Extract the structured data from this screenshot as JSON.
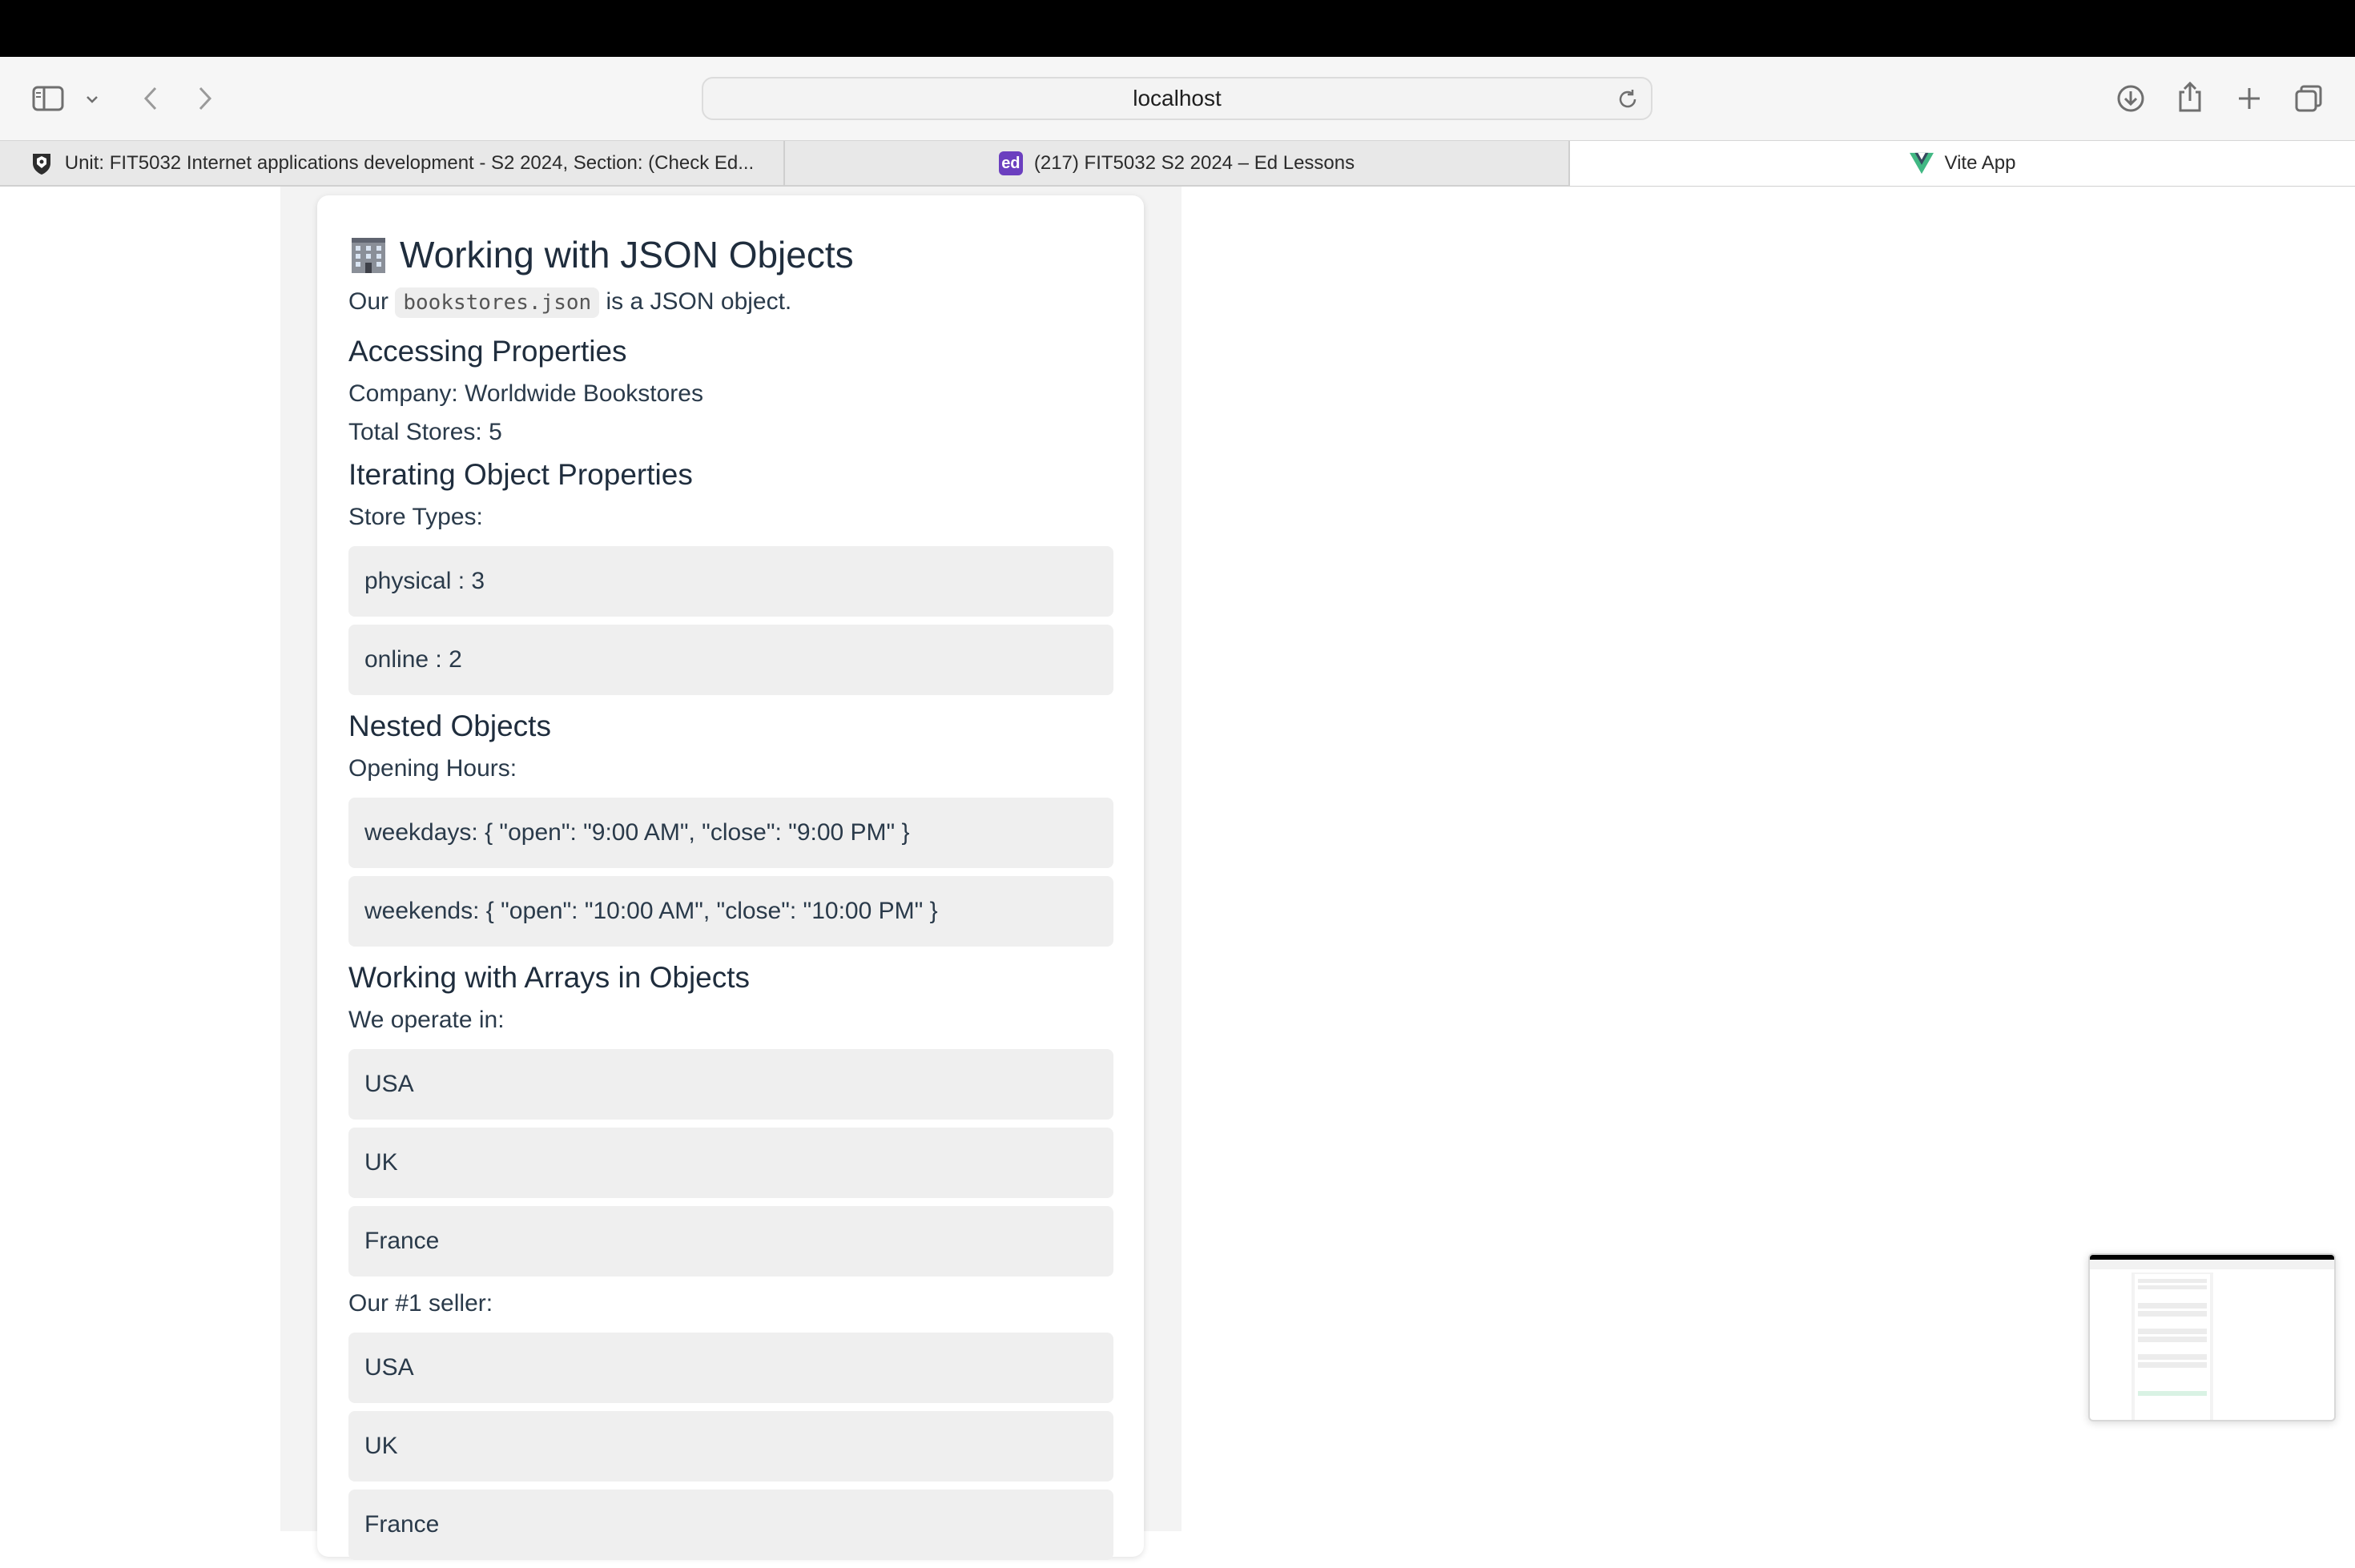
{
  "browser": {
    "url": "localhost",
    "tabs": [
      {
        "title": "Unit: FIT5032 Internet applications development - S2 2024, Section: (Check Ed...",
        "favicon": "monash-crest-icon",
        "active": false
      },
      {
        "title": "(217) FIT5032 S2 2024 – Ed Lessons",
        "favicon": "ed-logo-icon",
        "favicon_text": "ed",
        "active": false
      },
      {
        "title": "Vite App",
        "favicon": "vue-logo-icon",
        "active": true
      }
    ]
  },
  "page": {
    "title": "Working with JSON Objects",
    "title_icon": "building-icon",
    "intro": {
      "before": "Our",
      "code": "bookstores.json",
      "after": "is a JSON object."
    },
    "accessing": {
      "heading": "Accessing Properties",
      "company": "Company: Worldwide Bookstores",
      "total_stores": "Total Stores: 5"
    },
    "iterating": {
      "heading": "Iterating Object Properties",
      "label": "Store Types:",
      "items": [
        "physical : 3",
        "online : 2"
      ]
    },
    "nested": {
      "heading": "Nested Objects",
      "label": "Opening Hours:",
      "items": [
        "weekdays: { \"open\": \"9:00 AM\", \"close\": \"9:00 PM\" }",
        "weekends: { \"open\": \"10:00 AM\", \"close\": \"10:00 PM\" }"
      ]
    },
    "arrays": {
      "heading": "Working with Arrays in Objects",
      "label": "We operate in:",
      "items": [
        "USA",
        "UK",
        "France"
      ],
      "seller_label": "Our #1 seller:",
      "seller_items": [
        "USA",
        "UK",
        "France"
      ]
    }
  },
  "colors": {
    "ed_brand": "#6b3fbf",
    "vue_green": "#41b883",
    "vue_dark": "#35495e"
  }
}
